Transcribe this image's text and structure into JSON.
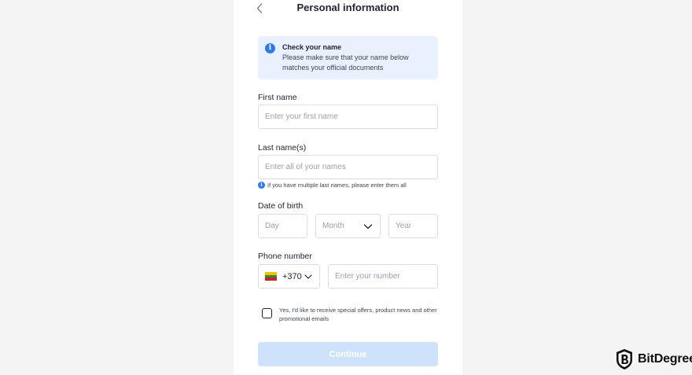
{
  "header": {
    "title": "Personal information",
    "back_icon": "chevron-left-icon"
  },
  "info_box": {
    "icon": "info-icon",
    "icon_glyph": "i",
    "title": "Check your name",
    "text": "Please make sure that your name below matches your official documents"
  },
  "form": {
    "first_name": {
      "label": "First name",
      "placeholder": "Enter your first name",
      "value": ""
    },
    "last_name": {
      "label": "Last name(s)",
      "placeholder": "Enter all of your names",
      "value": "",
      "hint": "If you have multiple last names, please enter them all",
      "hint_glyph": "i"
    },
    "date_of_birth": {
      "label": "Date of birth",
      "day_placeholder": "Day",
      "month_placeholder": "Month",
      "year_placeholder": "Year"
    },
    "phone": {
      "label": "Phone number",
      "country_code": "+370",
      "flag_icon": "lithuania-flag-icon",
      "flag_colors": [
        "#f6c300",
        "#2b8a3e",
        "#c1272d"
      ],
      "placeholder": "Enter your number",
      "value": ""
    },
    "consent": {
      "checked": false,
      "text": "Yes, I'd like to receive special offers, product news and other promotional emails"
    },
    "continue_label": "Continue"
  },
  "watermark": {
    "text": "BitDegree",
    "logo_icon": "bitdegree-logo-icon"
  },
  "colors": {
    "accent": "#2f7be6",
    "info_bg": "#e9f1fe",
    "button_disabled": "#cfe2fb",
    "page_bg": "#f4f4f5"
  }
}
